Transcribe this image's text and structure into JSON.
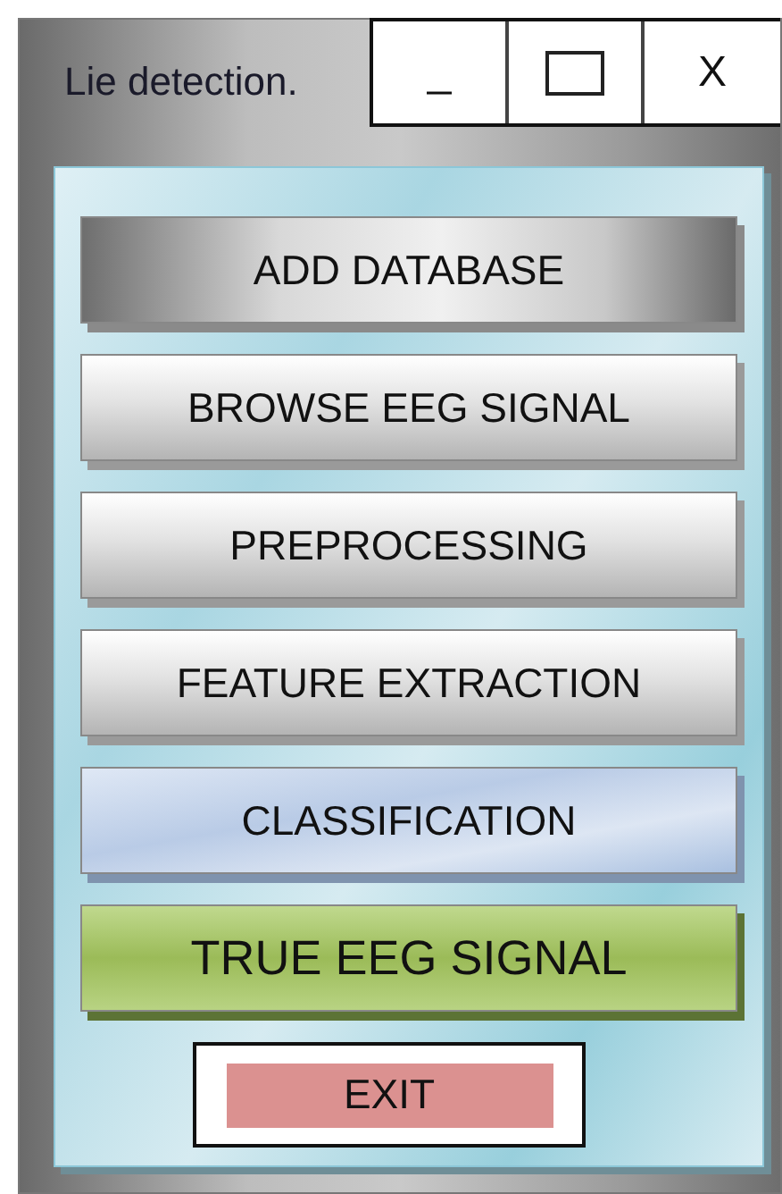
{
  "window": {
    "title": "Lie detection.",
    "controls": [
      {
        "kind": "minimize",
        "label": "_"
      },
      {
        "kind": "maximize"
      },
      {
        "kind": "close",
        "label": "X"
      }
    ]
  },
  "buttons": [
    {
      "label": "ADD DATABASE",
      "kind": "dark"
    },
    {
      "label": "BROWSE EEG SIGNAL",
      "kind": "silver"
    },
    {
      "label": "PREPROCESSING",
      "kind": "silver"
    },
    {
      "label": "FEATURE EXTRACTION",
      "kind": "silver"
    },
    {
      "label": "CLASSIFICATION",
      "kind": "blue"
    },
    {
      "label": "TRUE EEG SIGNAL",
      "kind": "green"
    }
  ],
  "exit_button": {
    "label": "EXIT"
  }
}
